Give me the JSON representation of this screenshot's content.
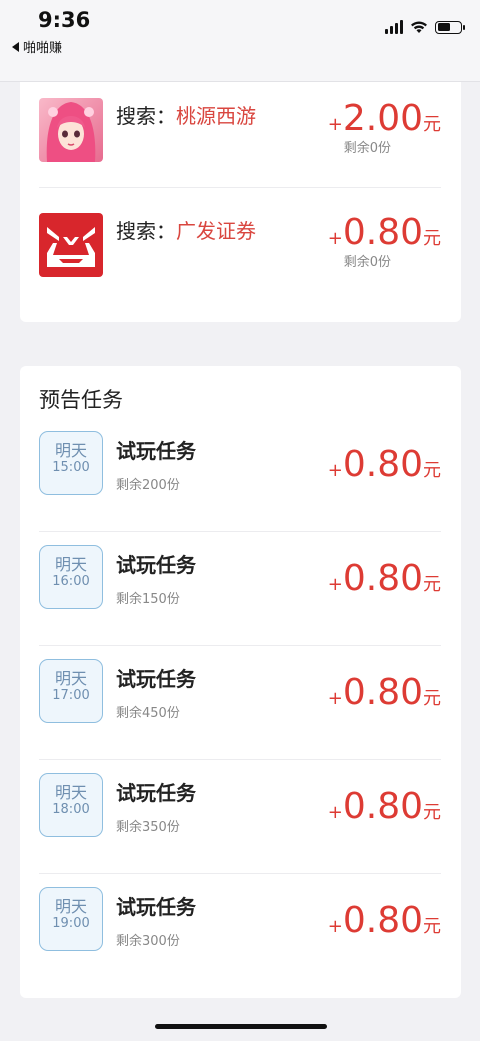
{
  "status_bar": {
    "time": "9:36",
    "back_app": "啪啪赚"
  },
  "search_tasks": [
    {
      "icon": "taoyuan-xiyou-app-icon",
      "prefix": "搜索：",
      "keyword": "桃源西游",
      "plus": "+",
      "amount": "2.00",
      "unit": "元",
      "remaining": "剩余0份"
    },
    {
      "icon": "guangfa-securities-app-icon",
      "prefix": "搜索：",
      "keyword": "广发证券",
      "plus": "+",
      "amount": "0.80",
      "unit": "元",
      "remaining": "剩余0份"
    }
  ],
  "preview": {
    "title": "预告任务",
    "tasks": [
      {
        "day": "明天",
        "hour": "15:00",
        "title": "试玩任务",
        "remaining": "剩余200份",
        "plus": "+",
        "amount": "0.80",
        "unit": "元"
      },
      {
        "day": "明天",
        "hour": "16:00",
        "title": "试玩任务",
        "remaining": "剩余150份",
        "plus": "+",
        "amount": "0.80",
        "unit": "元"
      },
      {
        "day": "明天",
        "hour": "17:00",
        "title": "试玩任务",
        "remaining": "剩余450份",
        "plus": "+",
        "amount": "0.80",
        "unit": "元"
      },
      {
        "day": "明天",
        "hour": "18:00",
        "title": "试玩任务",
        "remaining": "剩余350份",
        "plus": "+",
        "amount": "0.80",
        "unit": "元"
      },
      {
        "day": "明天",
        "hour": "19:00",
        "title": "试玩任务",
        "remaining": "剩余300份",
        "plus": "+",
        "amount": "0.80",
        "unit": "元"
      }
    ]
  },
  "colors": {
    "amount_red": "#dd3b34",
    "keyword_red": "#d9463f",
    "badge_border": "#8fbedf",
    "background": "#f1f1f4"
  }
}
